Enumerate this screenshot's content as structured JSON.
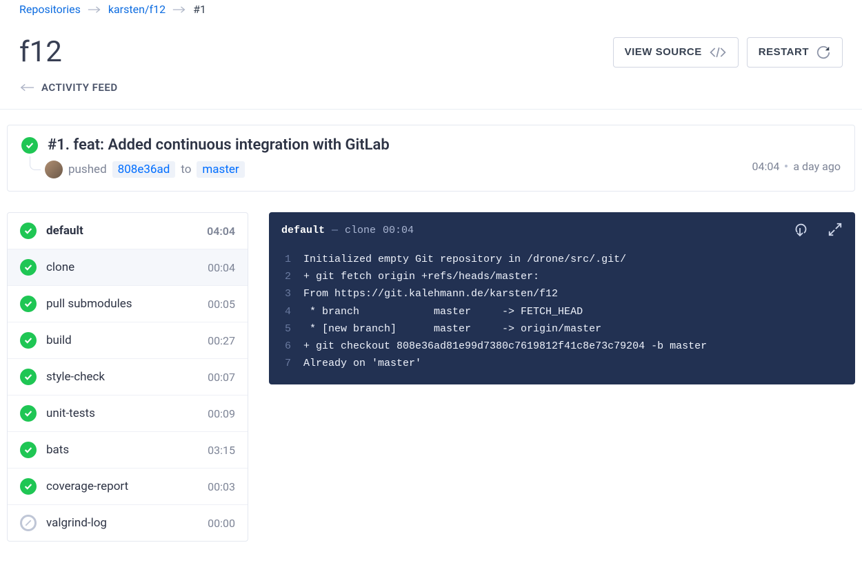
{
  "breadcrumbs": {
    "repositories": "Repositories",
    "repo": "karsten/f12",
    "current": "#1"
  },
  "title": "f12",
  "header_buttons": {
    "view_source": "VIEW SOURCE",
    "restart": "RESTART"
  },
  "activity_feed_label": "ACTIVITY FEED",
  "summary": {
    "title": "#1. feat: Added continuous integration with GitLab",
    "pushed": "pushed",
    "commit": "808e36ad",
    "to": "to",
    "branch": "master",
    "time": "04:04",
    "relative": "a day ago"
  },
  "steps": [
    {
      "name": "default",
      "time": "04:04",
      "status": "success",
      "header": true
    },
    {
      "name": "clone",
      "time": "00:04",
      "status": "success",
      "selected": true
    },
    {
      "name": "pull submodules",
      "time": "00:05",
      "status": "success"
    },
    {
      "name": "build",
      "time": "00:27",
      "status": "success"
    },
    {
      "name": "style-check",
      "time": "00:07",
      "status": "success"
    },
    {
      "name": "unit-tests",
      "time": "00:09",
      "status": "success"
    },
    {
      "name": "bats",
      "time": "03:15",
      "status": "success"
    },
    {
      "name": "coverage-report",
      "time": "00:03",
      "status": "success"
    },
    {
      "name": "valgrind-log",
      "time": "00:00",
      "status": "skipped"
    }
  ],
  "console": {
    "stage": "default",
    "dash": "—",
    "step": "clone",
    "duration": "00:04",
    "lines": [
      "Initialized empty Git repository in /drone/src/.git/",
      "+ git fetch origin +refs/heads/master:",
      "From https://git.kalehmann.de/karsten/f12",
      " * branch            master     -> FETCH_HEAD",
      " * [new branch]      master     -> origin/master",
      "+ git checkout 808e36ad81e99d7380c7619812f41c8e73c79204 -b master",
      "Already on 'master'"
    ]
  }
}
